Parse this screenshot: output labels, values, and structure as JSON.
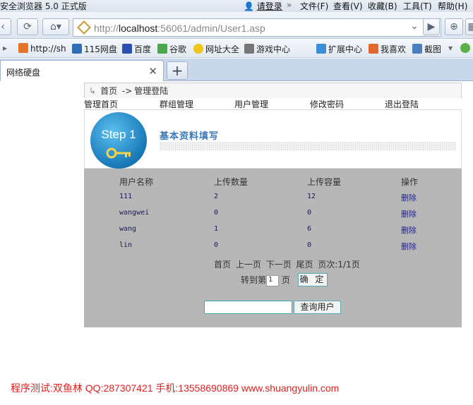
{
  "browser": {
    "title": "安全浏览器 5.0 正式版",
    "menu": {
      "login": "请登录",
      "file": "文件(F)",
      "view": "查看(V)",
      "favorites": "收藏(B)",
      "tools": "工具(T)",
      "help": "帮助(H)"
    },
    "url_prefix": "http://",
    "url_host": "localhost",
    "url_rest": ":56061/admin/User1.asp",
    "favorites_bar": [
      "http://sh",
      "115网盘",
      "百度",
      "谷歌",
      "网址大全",
      "游戏中心",
      "扩展中心",
      "我喜欢",
      "截图"
    ],
    "tab_label": "网络硬盘"
  },
  "page": {
    "breadcrumb": {
      "home": "首页",
      "arrow": "->",
      "current": "管理登陆"
    },
    "nav": [
      "管理首页",
      "群组管理",
      "用户管理",
      "修改密码",
      "退出登陆"
    ],
    "banner": {
      "step": "Step 1",
      "title": "基本资料填写"
    },
    "table": {
      "headers": [
        "用户名称",
        "上传数量",
        "上传容量",
        "操作"
      ],
      "rows": [
        {
          "name": "111",
          "count": "2",
          "size": "12",
          "action": "删除"
        },
        {
          "name": "wangwei",
          "count": "0",
          "size": "0",
          "action": "删除"
        },
        {
          "name": "wang",
          "count": "1",
          "size": "6",
          "action": "删除"
        },
        {
          "name": "lin",
          "count": "0",
          "size": "0",
          "action": "删除"
        }
      ]
    },
    "pager": {
      "first": "首页",
      "prev": "上一页",
      "next": "下一页",
      "last": "尾页",
      "status": "页次:1/1页"
    },
    "goto": {
      "prefix": "转到第",
      "value": "1",
      "suffix": "页",
      "ok": "确 定"
    },
    "search": {
      "value": "",
      "button": "查询用户"
    }
  },
  "footer": "程序测试:双鱼林 QQ:287307421 手机:13558690869 www.shuangyulin.com"
}
